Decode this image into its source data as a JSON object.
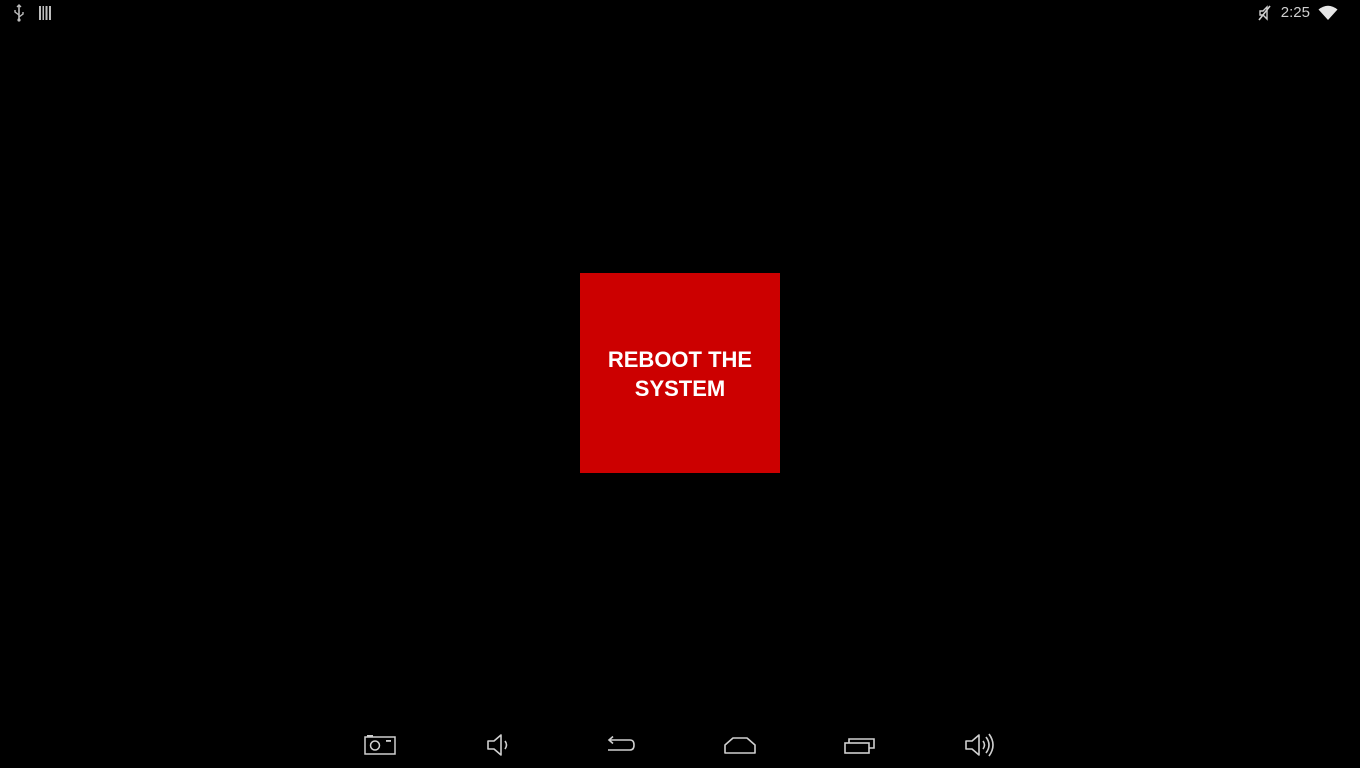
{
  "status_bar": {
    "time": "2:25",
    "left_icons": [
      "usb-icon",
      "barcode-icon"
    ],
    "right_icons": [
      "mute-icon",
      "wifi-icon"
    ]
  },
  "main": {
    "reboot_button_label": "REBOOT THE SYSTEM",
    "reboot_button_color": "#cc0000"
  },
  "nav_bar": {
    "buttons": [
      "screenshot-icon",
      "volume-down-icon",
      "back-icon",
      "home-icon",
      "recent-apps-icon",
      "volume-up-icon"
    ]
  }
}
